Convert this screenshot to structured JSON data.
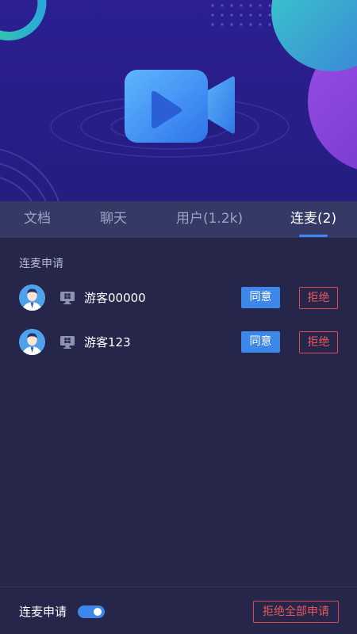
{
  "player": {
    "icon": "video-camera-icon"
  },
  "tabs": [
    {
      "label": "文档"
    },
    {
      "label": "聊天"
    },
    {
      "label": "用户(1.2k)"
    },
    {
      "label": "连麦(2)",
      "active": true
    }
  ],
  "requests": {
    "title": "连麦申请",
    "items": [
      {
        "name": "游客00000",
        "device_icon": "windows-desktop-icon",
        "agree_label": "同意",
        "reject_label": "拒绝"
      },
      {
        "name": "游客123",
        "device_icon": "windows-desktop-icon",
        "agree_label": "同意",
        "reject_label": "拒绝"
      }
    ]
  },
  "footer": {
    "toggle_label": "连麦申请",
    "toggle_on": true,
    "reject_all_label": "拒绝全部申请"
  },
  "colors": {
    "background": "#25264a",
    "tab_bar": "#343965",
    "accent": "#3d87e9",
    "danger": "#e8585c",
    "hero": "#2a1f8f"
  }
}
